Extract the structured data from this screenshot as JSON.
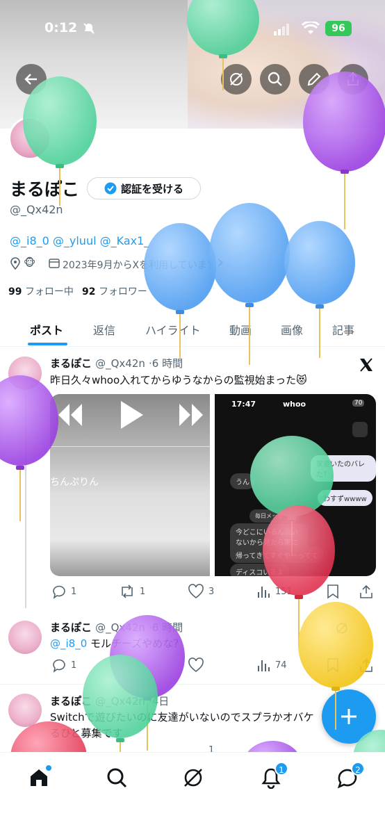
{
  "status_bar": {
    "time": "0:12",
    "battery": "96"
  },
  "profile": {
    "name": "まるぽこ",
    "verify_label": "認証を受ける",
    "handle": "@_Qx42n",
    "mentions": "@_i8_0 @_yluul @_Kax1_",
    "location_emoji": "🐵",
    "joined": "2023年9月からXを利用しています",
    "following_count": "99",
    "following_label": "フォロー中",
    "followers_count": "92",
    "followers_label": "フォロワー"
  },
  "tabs": [
    "ポスト",
    "返信",
    "ハイライト",
    "動画",
    "画像",
    "記事"
  ],
  "posts": [
    {
      "name": "まるぽこ",
      "handle": "@_Qx42n",
      "time": "·6 時間",
      "text": "昨日久々whoo入れてからゆうなからの監視始まった😻",
      "media_left_caption": "ちんぷりん",
      "media_right": {
        "time": "17:47",
        "app": "whoo",
        "battery": "70",
        "messages": [
          "家遊いたのバレた？",
          "うん",
          "わすずwwww",
          "毎日メッセー…",
          "今どこにいるん…いないから見たら家にいた",
          "帰ってきてすぐやーってて",
          "ディスコいるよ"
        ]
      },
      "replies": "1",
      "reposts": "1",
      "likes": "3",
      "views": "151"
    },
    {
      "name": "まるぽこ",
      "handle": "@_Qx42n",
      "time": "·6 時間",
      "mention": "@_i8_0",
      "text": "モルチーズやめな？",
      "replies": "1",
      "views": "74"
    },
    {
      "name": "まるぽこ",
      "handle": "@_Qx42n",
      "time": "·4日",
      "text_line1": "Switchで遊びたいのに友達がいないのでスプラかオバケ",
      "text_line2": "るひと募集です",
      "likes": "1"
    }
  ],
  "nav": {
    "notifications_badge": "1",
    "messages_badge": "2"
  },
  "colors": {
    "accent": "#1d9bf0",
    "text": "#0f1419",
    "muted": "#536471"
  }
}
